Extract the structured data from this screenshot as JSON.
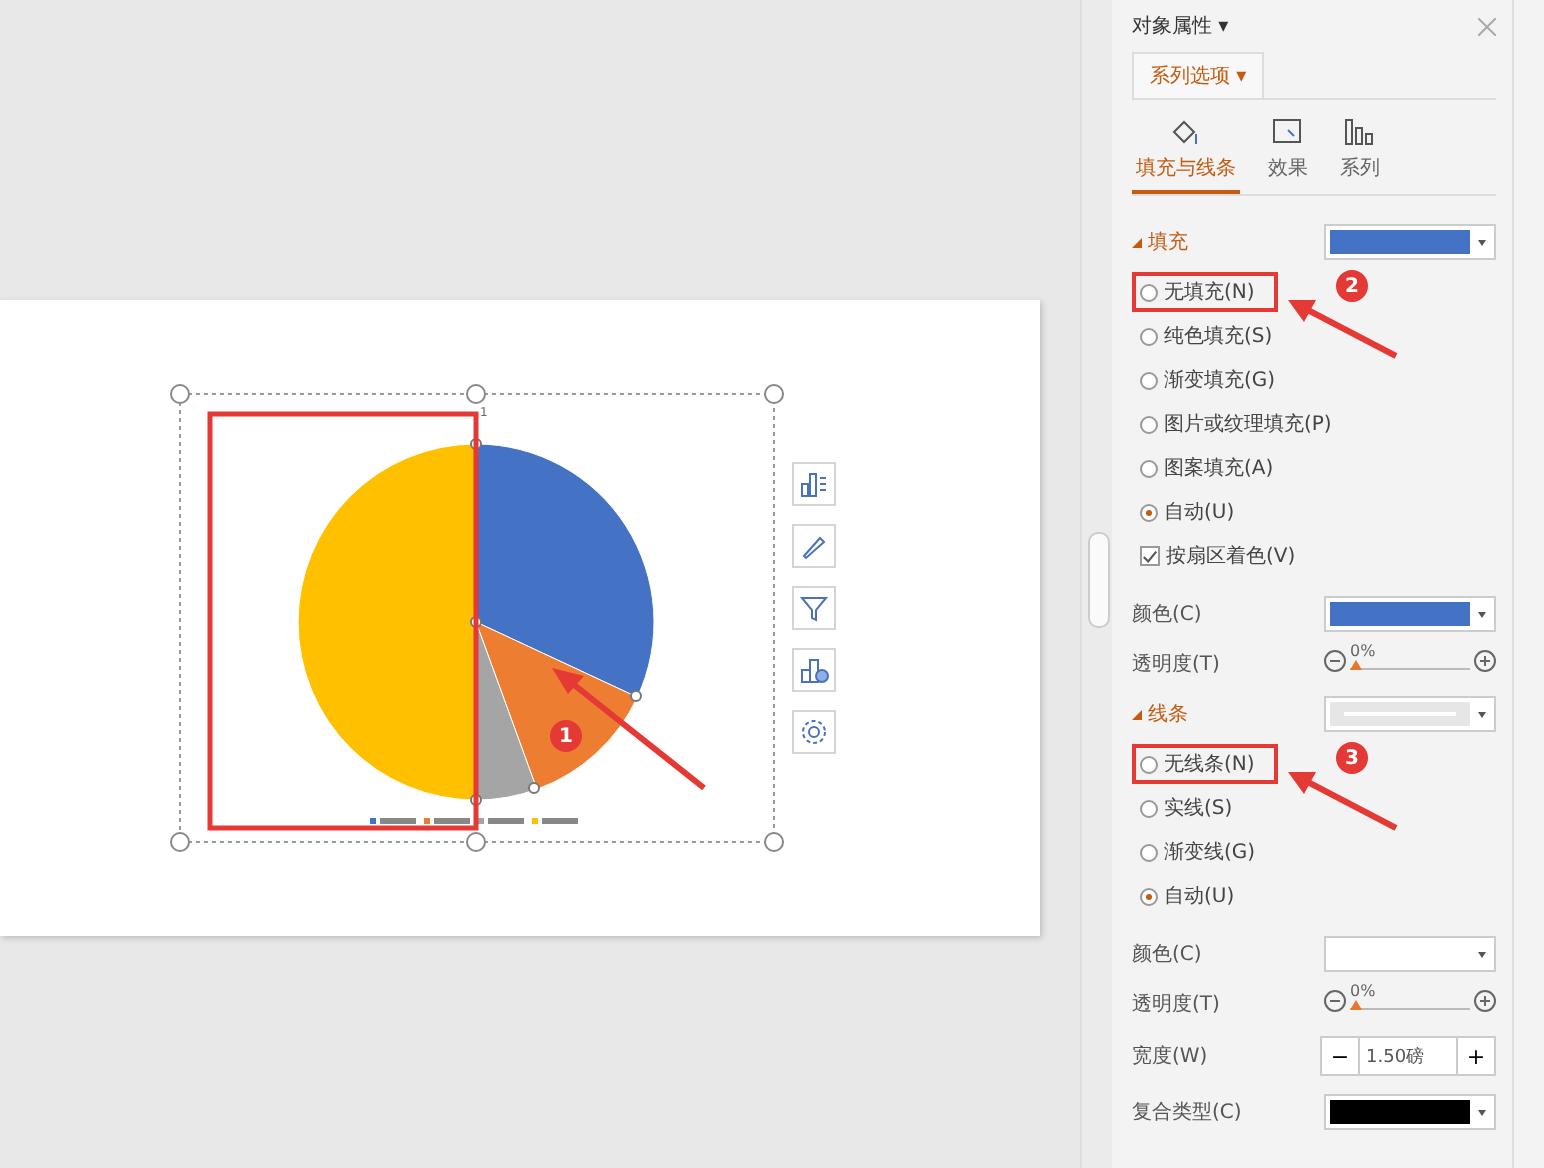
{
  "slide": {
    "chart": {
      "top_label": "1",
      "step_badge": "1"
    },
    "chart_tools": [
      {
        "kind": "elements"
      },
      {
        "kind": "style"
      },
      {
        "kind": "filter"
      },
      {
        "kind": "chart-type"
      },
      {
        "kind": "settings"
      }
    ]
  },
  "panel": {
    "title": "对象属性",
    "title_caret": "▾",
    "tab": {
      "label": "系列选项",
      "caret": "▾"
    },
    "subtabs": [
      {
        "label": "填充与线条",
        "selected": true,
        "kind": "fill"
      },
      {
        "label": "效果",
        "selected": false,
        "kind": "effect"
      },
      {
        "label": "系列",
        "selected": false,
        "kind": "series"
      }
    ],
    "fill": {
      "title": "填充",
      "color": "#4472c4",
      "step_badge": "2",
      "options": [
        {
          "kind": "radio",
          "label": "无填充(N)",
          "selected": false,
          "highlighted": true
        },
        {
          "kind": "radio",
          "label": "纯色填充(S)",
          "selected": false,
          "highlighted": false
        },
        {
          "kind": "radio",
          "label": "渐变填充(G)",
          "selected": false,
          "highlighted": false
        },
        {
          "kind": "radio",
          "label": "图片或纹理填充(P)",
          "selected": false,
          "highlighted": false
        },
        {
          "kind": "radio",
          "label": "图案填充(A)",
          "selected": false,
          "highlighted": false
        },
        {
          "kind": "radio",
          "label": "自动(U)",
          "selected": true,
          "highlighted": false
        },
        {
          "kind": "checkbox",
          "label": "按扇区着色(V)",
          "checked": true,
          "highlighted": false
        }
      ],
      "color_label": "颜色(C)",
      "transparency_label": "透明度(T)",
      "transparency_value": "0%",
      "level": 0
    },
    "line": {
      "title": "线条",
      "step_badge": "3",
      "options": [
        {
          "kind": "radio",
          "label": "无线条(N)",
          "selected": false,
          "highlighted": true
        },
        {
          "kind": "radio",
          "label": "实线(S)",
          "selected": false,
          "highlighted": false
        },
        {
          "kind": "radio",
          "label": "渐变线(G)",
          "selected": false,
          "highlighted": false
        },
        {
          "kind": "radio",
          "label": "自动(U)",
          "selected": true,
          "highlighted": false
        }
      ],
      "color_label": "颜色(C)",
      "transparency_label": "透明度(T)",
      "transparency_value": "0%",
      "level": 0,
      "width_label": "宽度(W)",
      "width_value": "1.50磅",
      "minus": "−",
      "plus": "+",
      "compound_label": "复合类型(C)"
    }
  }
}
